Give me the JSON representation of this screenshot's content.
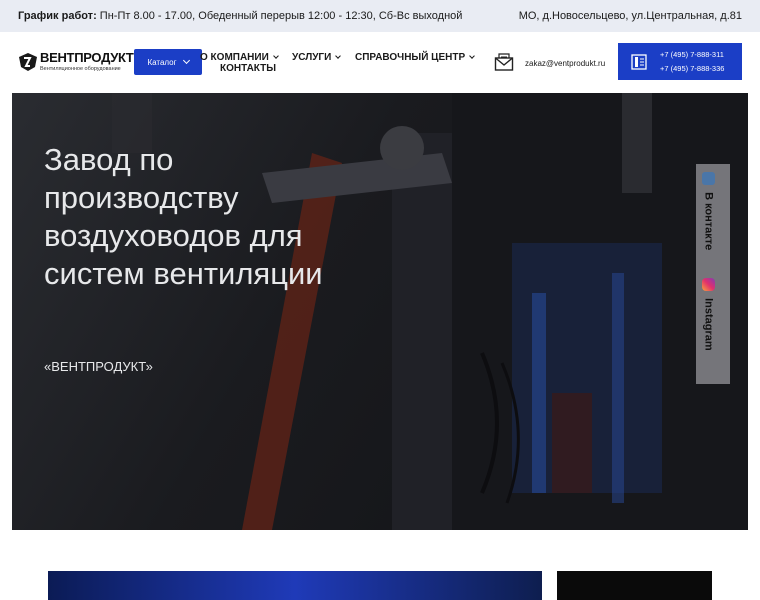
{
  "topbar": {
    "schedule_label": "График работ:",
    "schedule_text": "Пн-Пт 8.00 - 17.00, Обеденный перерыв 12:00 - 12:30, Сб-Вс выходной",
    "address": "МО, д.Новосельцево, ул.Центральная, д.81"
  },
  "header": {
    "logo_name": "ВЕНТПРОДУКТ",
    "logo_sub": "Вентиляционное оборудование",
    "catalog_label": "Каталог",
    "nav": {
      "about": "О КОМПАНИИ",
      "contacts": "КОНТАКТЫ",
      "services": "УСЛУГИ",
      "help": "СПРАВОЧНЫЙ ЦЕНТР"
    },
    "email": "zakaz@ventprodukt.ru",
    "phone1": "+7 (495) 7-888-311",
    "phone2": "+7 (495) 7-888-336"
  },
  "hero": {
    "title": "Завод по производству воздуховодов для систем вентиляции",
    "tagline": "«ВЕНТПРОДУКТ»"
  },
  "social": {
    "vk_label": "В контакте",
    "ig_label": "Instagram"
  },
  "colors": {
    "accent": "#1b3ec6",
    "topbar_bg": "#e9ecf3"
  }
}
